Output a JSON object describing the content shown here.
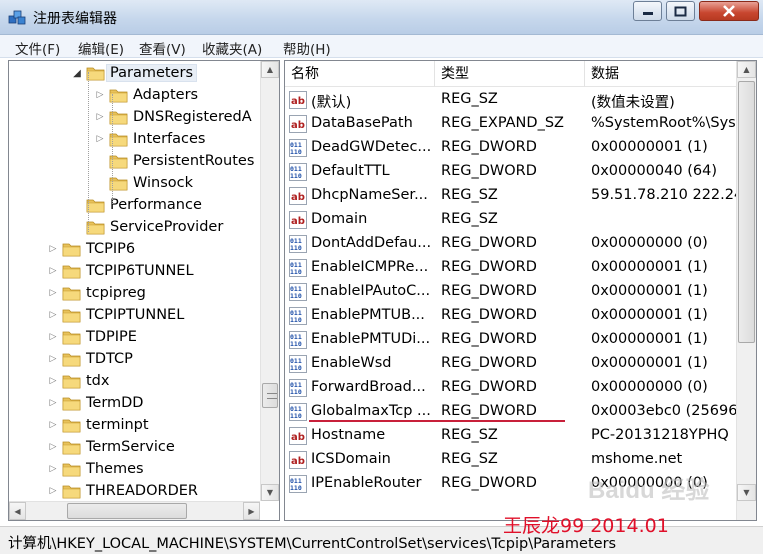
{
  "window": {
    "title": "注册表编辑器",
    "controls": {
      "minimize": "minimize-icon",
      "maximize": "maximize-icon",
      "close": "close-icon"
    }
  },
  "menu": [
    "文件(F)",
    "编辑(E)",
    "查看(V)",
    "收藏夹(A)",
    "帮助(H)"
  ],
  "tree": [
    {
      "label": "Parameters",
      "level": 2,
      "arrow": "expanded",
      "selected": true
    },
    {
      "label": "Adapters",
      "level": 3,
      "arrow": "collapsed"
    },
    {
      "label": "DNSRegisteredA",
      "level": 3,
      "arrow": "collapsed"
    },
    {
      "label": "Interfaces",
      "level": 3,
      "arrow": "collapsed"
    },
    {
      "label": "PersistentRoutes",
      "level": 3,
      "arrow": "none"
    },
    {
      "label": "Winsock",
      "level": 3,
      "arrow": "none"
    },
    {
      "label": "Performance",
      "level": 2,
      "arrow": "none"
    },
    {
      "label": "ServiceProvider",
      "level": 2,
      "arrow": "none"
    },
    {
      "label": "TCPIP6",
      "level": 1,
      "arrow": "collapsed"
    },
    {
      "label": "TCPIP6TUNNEL",
      "level": 1,
      "arrow": "collapsed"
    },
    {
      "label": "tcpipreg",
      "level": 1,
      "arrow": "collapsed"
    },
    {
      "label": "TCPIPTUNNEL",
      "level": 1,
      "arrow": "collapsed"
    },
    {
      "label": "TDPIPE",
      "level": 1,
      "arrow": "collapsed"
    },
    {
      "label": "TDTCP",
      "level": 1,
      "arrow": "collapsed"
    },
    {
      "label": "tdx",
      "level": 1,
      "arrow": "collapsed"
    },
    {
      "label": "TermDD",
      "level": 1,
      "arrow": "collapsed"
    },
    {
      "label": "terminpt",
      "level": 1,
      "arrow": "collapsed"
    },
    {
      "label": "TermService",
      "level": 1,
      "arrow": "collapsed"
    },
    {
      "label": "Themes",
      "level": 1,
      "arrow": "collapsed"
    },
    {
      "label": "THREADORDER",
      "level": 1,
      "arrow": "collapsed"
    }
  ],
  "columns": {
    "name": "名称",
    "type": "类型",
    "data": "数据"
  },
  "values": [
    {
      "icon": "string-value-icon",
      "name": "(默认)",
      "type": "REG_SZ",
      "data": "(数值未设置)"
    },
    {
      "icon": "string-value-icon",
      "name": "DataBasePath",
      "type": "REG_EXPAND_SZ",
      "data": "%SystemRoot%\\Sys"
    },
    {
      "icon": "binary-value-icon",
      "name": "DeadGWDetec...",
      "type": "REG_DWORD",
      "data": "0x00000001 (1)"
    },
    {
      "icon": "binary-value-icon",
      "name": "DefaultTTL",
      "type": "REG_DWORD",
      "data": "0x00000040 (64)"
    },
    {
      "icon": "string-value-icon",
      "name": "DhcpNameSer...",
      "type": "REG_SZ",
      "data": "59.51.78.210 222.24"
    },
    {
      "icon": "string-value-icon",
      "name": "Domain",
      "type": "REG_SZ",
      "data": ""
    },
    {
      "icon": "binary-value-icon",
      "name": "DontAddDefau...",
      "type": "REG_DWORD",
      "data": "0x00000000 (0)"
    },
    {
      "icon": "binary-value-icon",
      "name": "EnableICMPRe...",
      "type": "REG_DWORD",
      "data": "0x00000001 (1)"
    },
    {
      "icon": "binary-value-icon",
      "name": "EnableIPAutoC...",
      "type": "REG_DWORD",
      "data": "0x00000001 (1)"
    },
    {
      "icon": "binary-value-icon",
      "name": "EnablePMTUB...",
      "type": "REG_DWORD",
      "data": "0x00000001 (1)"
    },
    {
      "icon": "binary-value-icon",
      "name": "EnablePMTUDi...",
      "type": "REG_DWORD",
      "data": "0x00000001 (1)"
    },
    {
      "icon": "binary-value-icon",
      "name": "EnableWsd",
      "type": "REG_DWORD",
      "data": "0x00000001 (1)"
    },
    {
      "icon": "binary-value-icon",
      "name": "ForwardBroad...",
      "type": "REG_DWORD",
      "data": "0x00000000 (0)"
    },
    {
      "icon": "binary-value-icon",
      "name": "GlobalmaxTcp ...",
      "type": "REG_DWORD",
      "data": "0x0003ebc0 (25696"
    },
    {
      "icon": "string-value-icon",
      "name": "Hostname",
      "type": "REG_SZ",
      "data": "PC-20131218YPHQ"
    },
    {
      "icon": "string-value-icon",
      "name": "ICSDomain",
      "type": "REG_SZ",
      "data": "mshome.net"
    },
    {
      "icon": "binary-value-icon",
      "name": "IPEnableRouter",
      "type": "REG_DWORD",
      "data": "0x00000000 (0)"
    }
  ],
  "status": {
    "path": "计算机\\HKEY_LOCAL_MACHINE\\SYSTEM\\CurrentControlSet\\services\\Tcpip\\Parameters",
    "annotation": "王辰龙99 2014.01"
  },
  "watermark": "Baidu 经验",
  "colors": {
    "annotation": "#e0102a",
    "titlebar": "#c6d7ec",
    "close_button": "#c8462f"
  }
}
